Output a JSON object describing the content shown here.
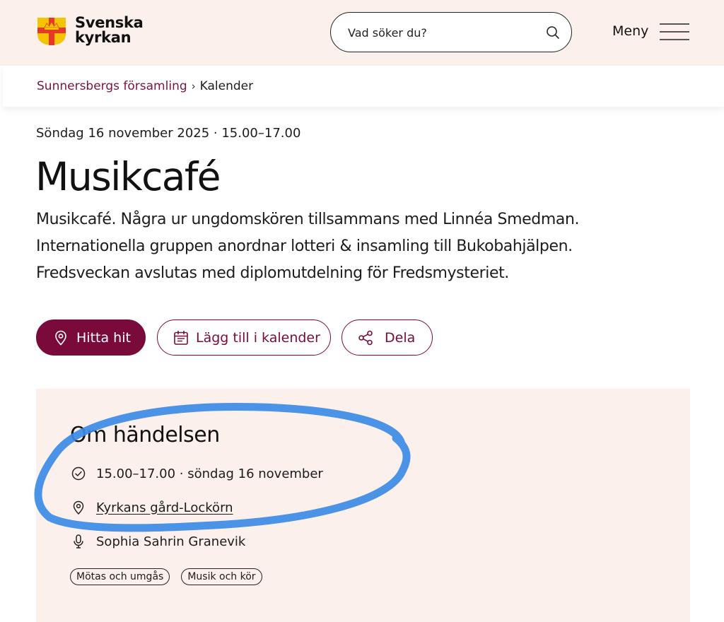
{
  "header": {
    "logo_line1": "Svenska",
    "logo_line2": "kyrkan",
    "search_placeholder": "Vad söker du?",
    "menu_label": "Meny"
  },
  "breadcrumb": {
    "parish": "Sunnersbergs församling",
    "separator": "›",
    "current": "Kalender"
  },
  "event": {
    "date_time": "Söndag 16 november 2025 · 15.00–17.00",
    "title": "Musikcafé",
    "description_lines": [
      "Musikcafé. Några ur ungdomskören tillsammans med Linnéa Smedman.",
      "Internationella gruppen anordnar lotteri & insamling till Bukobahjälpen.",
      "Fredsveckan avslutas med diplomutdelning för Fredsmysteriet."
    ]
  },
  "actions": {
    "directions_label": "Hitta hit",
    "add_calendar_label": "Lägg till i kalender",
    "share_label": "Dela"
  },
  "about": {
    "heading": "Om händelsen",
    "time": "15.00–17.00 · söndag 16 november",
    "place": "Kyrkans gård-Lockörn",
    "person": "Sophia Sahrin Granevik",
    "tags": [
      "Mötas och umgås",
      "Musik och kör"
    ]
  },
  "colors": {
    "brand": "#7a0a3a",
    "header_bg": "#fcf0ec",
    "card_bg": "#fcf0ec",
    "highlight_stroke": "#3b8be6"
  },
  "icons": {
    "logo": "svenska-kyrkan-cross-crown-icon",
    "search": "search-icon",
    "menu": "hamburger-icon",
    "directions": "map-pin-icon",
    "calendar": "calendar-icon",
    "share": "share-icon",
    "time": "clock-check-icon",
    "place": "map-pin-icon",
    "person": "microphone-icon"
  }
}
